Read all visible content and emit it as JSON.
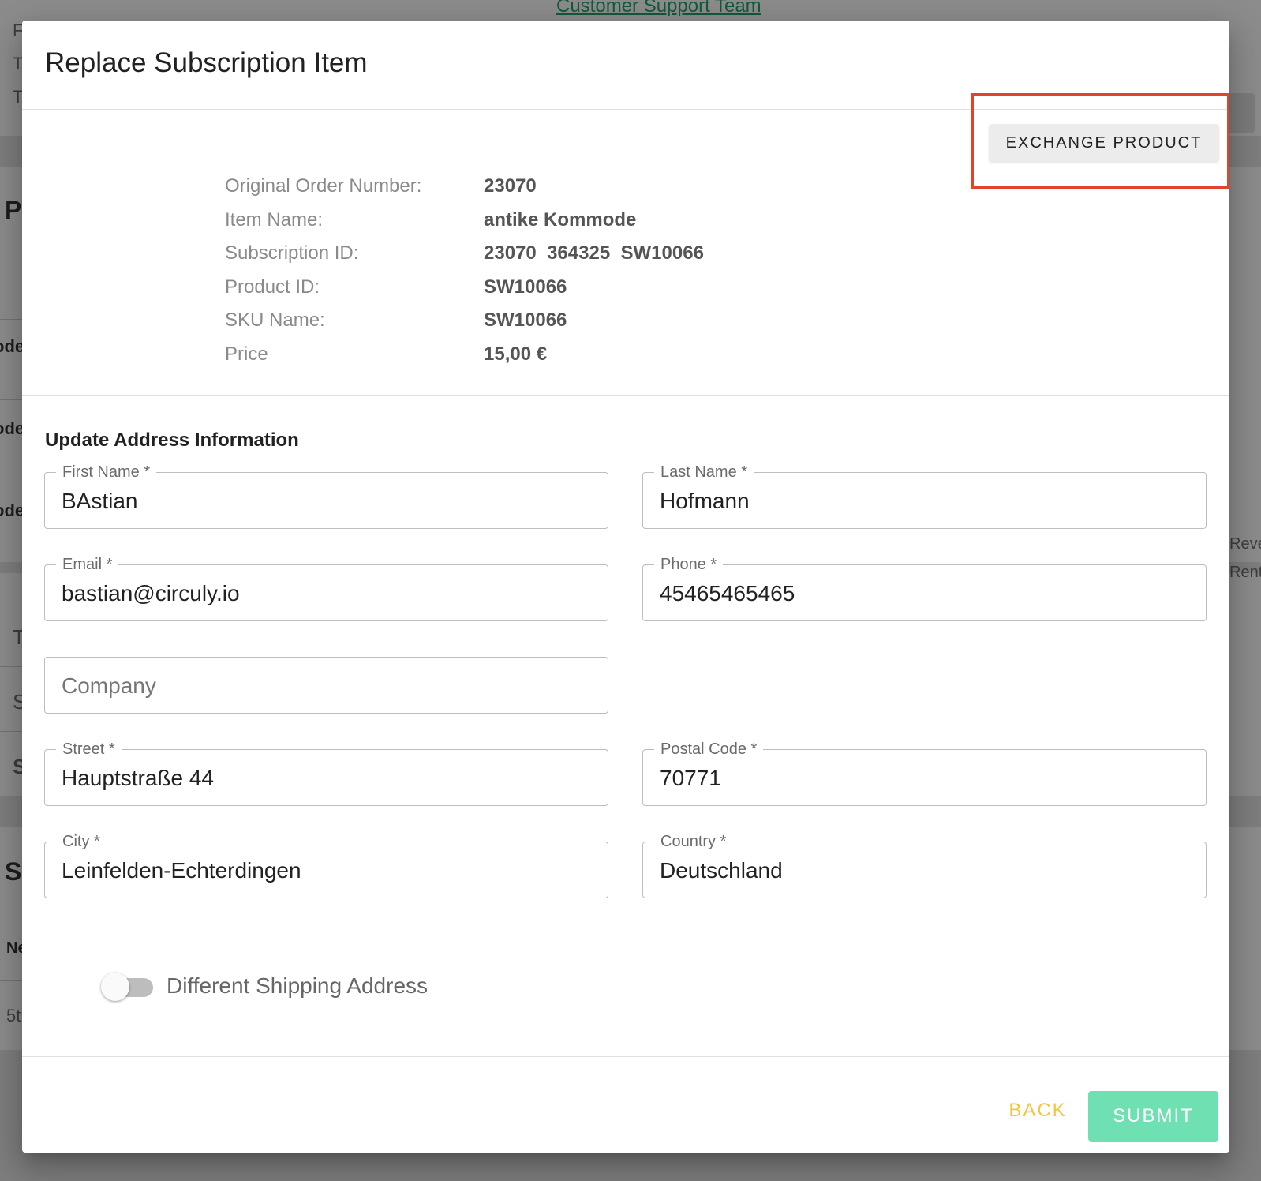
{
  "background": {
    "link_text": "Customer Support Team",
    "fragments": {
      "f1": "F",
      "f2": "T",
      "f3": "T",
      "p": "P",
      "ode1": "ode",
      "ode2": "ode",
      "ode3": "ode",
      "t": "T",
      "s1": "S",
      "s2": "S",
      "s3": "S",
      "ne": "Ne",
      "five": "5t",
      "rev": "Reve",
      "rent": "Rent"
    }
  },
  "dialog": {
    "title": "Replace Subscription Item",
    "exchange_button": "EXCHANGE PRODUCT",
    "info": [
      {
        "label": "Original Order Number:",
        "value": "23070"
      },
      {
        "label": "Item Name:",
        "value": "antike Kommode"
      },
      {
        "label": "Subscription ID:",
        "value": "23070_364325_SW10066"
      },
      {
        "label": "Product ID:",
        "value": "SW10066"
      },
      {
        "label": "SKU Name:",
        "value": "SW10066"
      },
      {
        "label": "Price",
        "value": "15,00 €"
      }
    ],
    "address_section_title": "Update Address Information",
    "fields": {
      "first_name": {
        "label": "First Name *",
        "value": "BAstian"
      },
      "last_name": {
        "label": "Last Name *",
        "value": "Hofmann"
      },
      "email": {
        "label": "Email *",
        "value": "bastian@circuly.io"
      },
      "phone": {
        "label": "Phone *",
        "value": "45465465465"
      },
      "company": {
        "placeholder": "Company",
        "value": ""
      },
      "street": {
        "label": "Street *",
        "value": "Hauptstraße 44"
      },
      "postal_code": {
        "label": "Postal Code *",
        "value": "70771"
      },
      "city": {
        "label": "City *",
        "value": "Leinfelden-Echterdingen"
      },
      "country": {
        "label": "Country *",
        "value": "Deutschland"
      }
    },
    "shipping_toggle": {
      "label": "Different Shipping Address",
      "checked": false
    },
    "back_button": "BACK",
    "submit_button": "SUBMIT"
  }
}
